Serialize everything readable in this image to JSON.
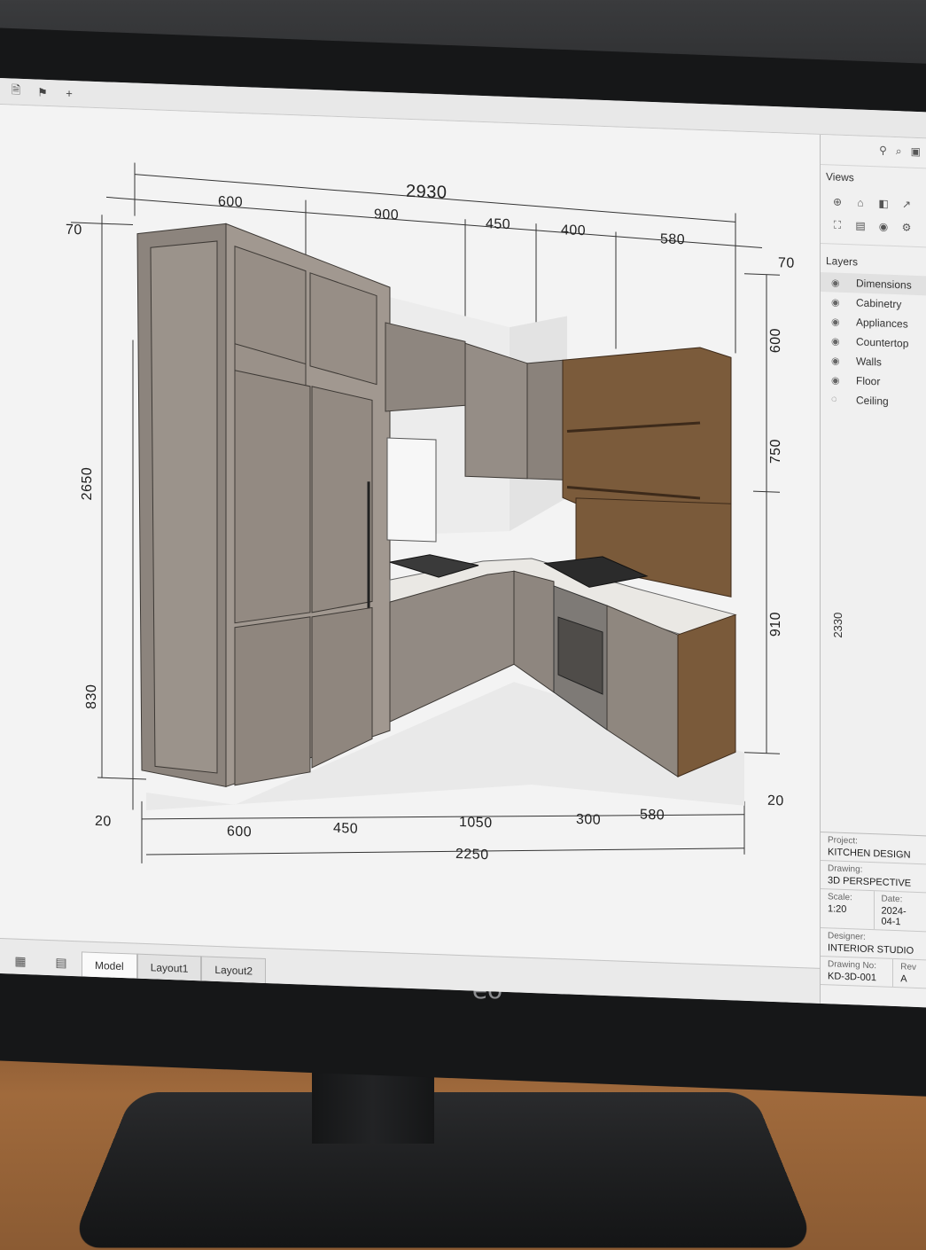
{
  "toolbar": {
    "icons": [
      "file-icon",
      "flag-icon",
      "plus-icon"
    ]
  },
  "canvas": {
    "top_dims": {
      "overall": "2930",
      "segments": [
        "600",
        "900",
        "450",
        "400",
        "580"
      ]
    },
    "bottom_dims": {
      "overall": "2250",
      "segments": [
        "600",
        "450",
        "1050",
        "300",
        "580"
      ]
    },
    "left_dims": {
      "top_offset": "70",
      "height": "2650",
      "base": "830",
      "bottom_offset": "20"
    },
    "right_dims": {
      "top_offset": "70",
      "upper": "600",
      "middle": "750",
      "lower": "910",
      "bottom_offset": "20"
    }
  },
  "right_panel": {
    "views_title": "Views",
    "layers_title": "Layers",
    "layers": [
      {
        "label": "Dimensions",
        "selected": true
      },
      {
        "label": "Cabinetry",
        "selected": false
      },
      {
        "label": "Appliances",
        "selected": false
      },
      {
        "label": "Countertop",
        "selected": false
      },
      {
        "label": "Walls",
        "selected": false
      },
      {
        "label": "Floor",
        "selected": false
      },
      {
        "label": "Ceiling",
        "selected": false
      }
    ],
    "side_dim": "2330",
    "title_block": {
      "project_label": "Project:",
      "project_value": "KITCHEN DESIGN",
      "drawing_label": "Drawing:",
      "drawing_value": "3D PERSPECTIVE",
      "scale_label": "Scale:",
      "scale_value": "1:20",
      "date_label": "Date:",
      "date_value": "2024-04-1",
      "designer_label": "Designer:",
      "designer_value": "INTERIOR STUDIO",
      "drawing_no_label": "Drawing No:",
      "drawing_no_value": "KD-3D-001",
      "rev_label": "Rev",
      "rev_value": "A"
    }
  },
  "bottom_tabs": [
    "Model",
    "Layout1",
    "Layout2"
  ],
  "monitor": {
    "brand": "eō"
  },
  "colors": {
    "cabinet_gray": "#8f8780",
    "cabinet_wood": "#7a5a3a",
    "countertop": "#e8e6e2",
    "screen_bg": "#f1f1f1",
    "desk": "#a06a3c"
  }
}
